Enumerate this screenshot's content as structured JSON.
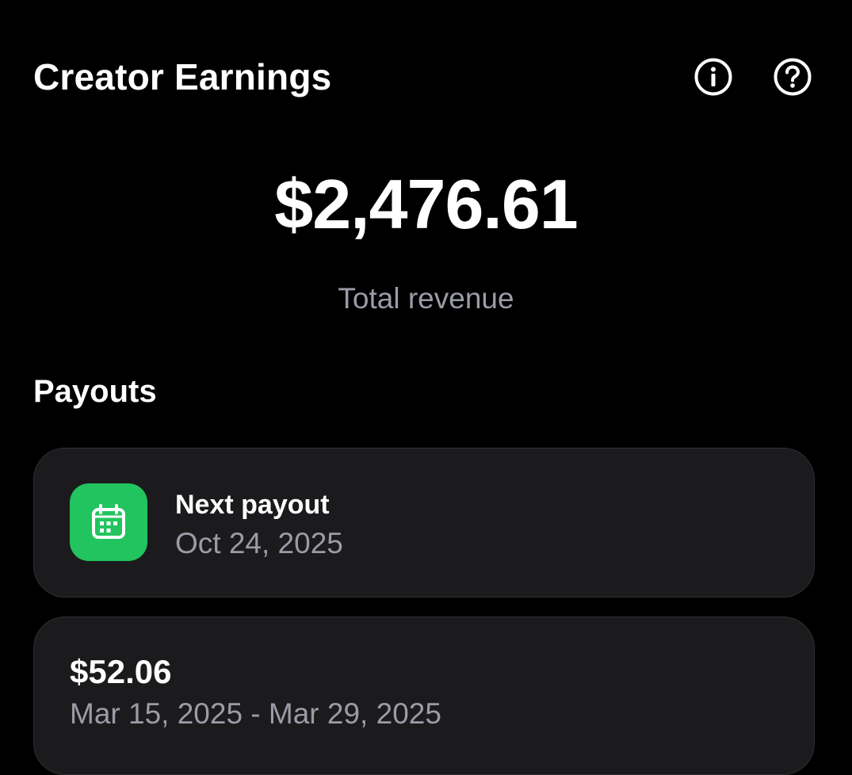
{
  "header": {
    "title": "Creator Earnings",
    "icons": [
      "info-icon",
      "help-icon"
    ]
  },
  "summary": {
    "total_amount": "$2,476.61",
    "total_label": "Total revenue"
  },
  "payouts": {
    "section_title": "Payouts",
    "next_payout": {
      "label": "Next payout",
      "date": "Oct 24, 2025",
      "icon": "calendar-icon",
      "icon_bg_color": "#21c45e"
    },
    "items": [
      {
        "amount": "$52.06",
        "period": "Mar 15, 2025 - Mar 29, 2025"
      }
    ]
  },
  "colors": {
    "background": "#000000",
    "card": "#1b1b1d",
    "muted_text": "#9a9ca6",
    "accent_green": "#21c45e"
  }
}
